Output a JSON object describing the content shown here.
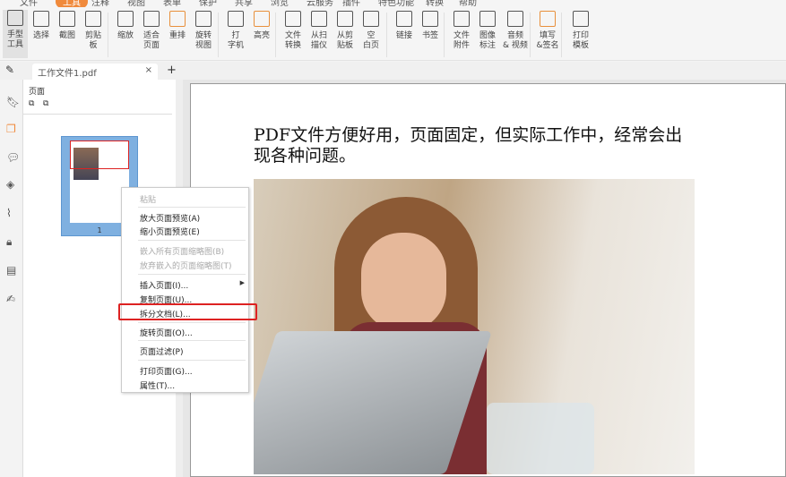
{
  "menu": {
    "items": [
      "文件",
      "工具",
      "注释",
      "视图",
      "表单",
      "保护",
      "共享",
      "浏览",
      "云服务",
      "插件",
      "特色功能",
      "转换",
      "帮助"
    ],
    "active": "工具",
    "accent": "#f08a3c"
  },
  "toolbar": {
    "buttons": [
      {
        "label": "手型\n工具",
        "icon": "hand-icon"
      },
      {
        "label": "选择",
        "icon": "select-text-icon"
      },
      {
        "label": "截图",
        "icon": "snapshot-icon"
      },
      {
        "label": "剪贴\n板",
        "icon": "clipboard-icon"
      },
      {
        "label": "缩放",
        "icon": "zoom-icon"
      },
      {
        "label": "适合\n页面",
        "icon": "fit-page-icon"
      },
      {
        "label": "重排",
        "icon": "reflow-icon"
      },
      {
        "label": "旋转\n视图",
        "icon": "rotate-view-icon"
      },
      {
        "label": "打\n字机",
        "icon": "typewriter-icon"
      },
      {
        "label": "高亮",
        "icon": "highlight-icon"
      },
      {
        "label": "文件\n转换",
        "icon": "file-convert-icon"
      },
      {
        "label": "从扫\n描仪",
        "icon": "scanner-icon"
      },
      {
        "label": "从剪\n贴板",
        "icon": "from-clipboard-icon"
      },
      {
        "label": "空\n白页",
        "icon": "blank-page-icon"
      },
      {
        "label": "链接",
        "icon": "link-icon"
      },
      {
        "label": "书签",
        "icon": "bookmark-icon"
      },
      {
        "label": "文件\n附件",
        "icon": "attachment-icon"
      },
      {
        "label": "图像\n标注",
        "icon": "image-annotation-icon"
      },
      {
        "label": "音频\n& 视频",
        "icon": "video-icon"
      },
      {
        "label": "填写\n&签名",
        "icon": "fill-sign-icon"
      },
      {
        "label": "打印\n模板",
        "icon": "print-icon"
      }
    ]
  },
  "tabs": {
    "file": "工作文件1.pdf",
    "close": "×",
    "add": "+"
  },
  "panel": {
    "title": "页面",
    "thumb_page": "1"
  },
  "document": {
    "heading": "PDF文件方便好用，页面固定，但实际工作中，经常会出现各种问题。"
  },
  "context_menu": {
    "items": [
      {
        "label": "粘贴",
        "disabled": true
      },
      {
        "label": "放大页面预览(A)"
      },
      {
        "label": "缩小页面预览(E)"
      },
      {
        "label": "嵌入所有页面缩略图(B)",
        "disabled": true
      },
      {
        "label": "放弃嵌入的页面缩略图(T)",
        "disabled": true
      },
      {
        "label": "插入页面(I)...",
        "submenu": true
      },
      {
        "label": "复制页面(U)..."
      },
      {
        "label": "拆分文档(L)...",
        "highlighted": true
      },
      {
        "label": "旋转页面(O)..."
      },
      {
        "label": "页面过滤(P)"
      },
      {
        "label": "打印页面(G)..."
      },
      {
        "label": "属性(T)..."
      }
    ]
  }
}
